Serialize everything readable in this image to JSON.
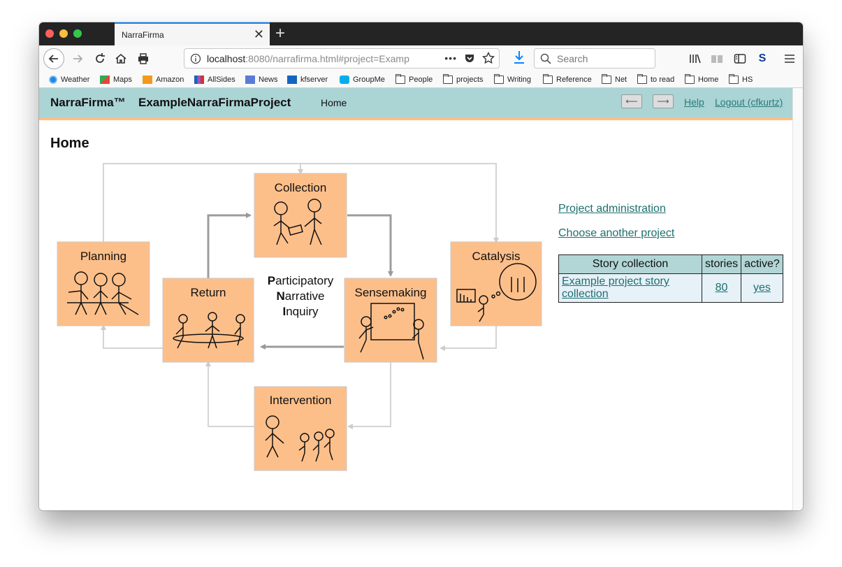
{
  "browser": {
    "tab_title": "NarraFirma",
    "url_host": "localhost",
    "url_rest": ":8080/narrafirma.html#project=Examp",
    "search_placeholder": "Search",
    "bookmarks": [
      "Weather",
      "Maps",
      "Amazon",
      "AllSides",
      "News",
      "kfserver",
      "GroupMe",
      "People",
      "projects",
      "Writing",
      "Reference",
      "Net",
      "to read",
      "Home",
      "HS"
    ]
  },
  "app": {
    "name": "NarraFirma™",
    "project": "ExampleNarraFirmaProject",
    "crumb": "Home",
    "help_link": "Help",
    "logout_link": "Logout (cfkurtz)"
  },
  "page": {
    "title": "Home",
    "links": [
      "Project administration",
      "Choose another project"
    ]
  },
  "diagram": {
    "center_lines": [
      {
        "bold": "P",
        "rest": "articipatory"
      },
      {
        "bold": "N",
        "rest": "arrative"
      },
      {
        "bold": "I",
        "rest": "nquiry"
      }
    ],
    "stages": [
      "Planning",
      "Collection",
      "Catalysis",
      "Return",
      "Sensemaking",
      "Intervention"
    ]
  },
  "story_table": {
    "headers": [
      "Story collection",
      "stories",
      "active?"
    ],
    "rows": [
      {
        "name": "Example project story collection",
        "stories": "80",
        "active": "yes"
      }
    ]
  },
  "colors": {
    "header_bg": "#abd4d5",
    "accent": "#fdbf85",
    "link": "#1d6f6f",
    "stage_box": "#fdbf8a"
  }
}
